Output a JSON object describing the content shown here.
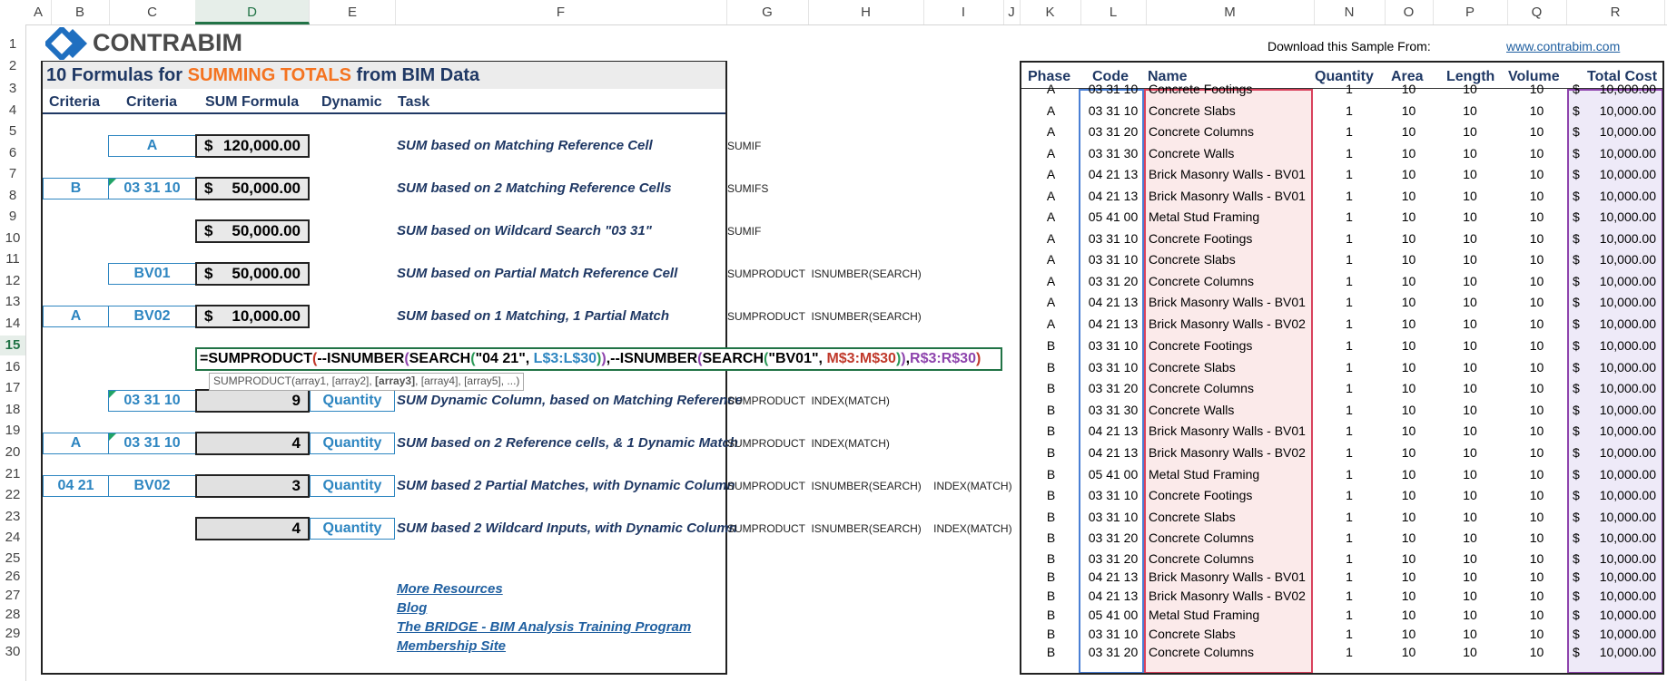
{
  "columns": [
    "A",
    "B",
    "C",
    "D",
    "E",
    "F",
    "G",
    "H",
    "I",
    "J",
    "K",
    "L",
    "M",
    "N",
    "O",
    "P",
    "Q",
    "R"
  ],
  "selected_column": "D",
  "rows": [
    "1",
    "2",
    "3",
    "4",
    "5",
    "6",
    "7",
    "8",
    "9",
    "10",
    "11",
    "12",
    "13",
    "14",
    "15",
    "16",
    "17",
    "18",
    "19",
    "20",
    "21",
    "22",
    "23",
    "24",
    "25",
    "26",
    "27",
    "28",
    "29",
    "30"
  ],
  "selected_row": "15",
  "logo": {
    "text": "CONTRABIM"
  },
  "download": {
    "label": "Download this Sample From:",
    "link": "www.contrabim.com"
  },
  "title": {
    "part1": "10 Formulas for ",
    "highlight": "SUMMING TOTALS",
    "part2": " from BIM Data"
  },
  "headers": {
    "criteria1": "Criteria",
    "criteria2": "Criteria",
    "sum_formula": "SUM Formula",
    "dynamic": "Dynamic",
    "task": "Task"
  },
  "formulas": [
    {
      "criteria1": "",
      "criteria2": "A",
      "dollar": "$",
      "value": "120,000.00",
      "dynamic": "",
      "task": "SUM based on Matching Reference Cell",
      "func": "SUMIF"
    },
    {
      "criteria1": "B",
      "criteria2": "03 31 10",
      "dollar": "$",
      "value": "50,000.00",
      "dynamic": "",
      "task": "SUM based on 2 Matching Reference Cells",
      "func": "SUMIFS"
    },
    {
      "criteria1": "",
      "criteria2": "",
      "dollar": "$",
      "value": "50,000.00",
      "dynamic": "",
      "task": "SUM based on Wildcard Search \"03 31\"",
      "func": "SUMIF"
    },
    {
      "criteria1": "",
      "criteria2": "BV01",
      "dollar": "$",
      "value": "50,000.00",
      "dynamic": "",
      "task": "SUM based on Partial Match Reference Cell",
      "func": "SUMPRODUCT  ISNUMBER(SEARCH)"
    },
    {
      "criteria1": "A",
      "criteria2": "BV02",
      "dollar": "$",
      "value": "10,000.00",
      "dynamic": "",
      "task": "SUM based on 1 Matching, 1 Partial Match",
      "func": "SUMPRODUCT  ISNUMBER(SEARCH)"
    },
    {
      "criteria1": "",
      "criteria2": "03 31 10",
      "dollar": "",
      "value": "9",
      "dynamic": "Quantity",
      "task": "SUM Dynamic Column, based on Matching Reference",
      "func": "SUMPRODUCT  INDEX(MATCH)"
    },
    {
      "criteria1": "A",
      "criteria2": "03 31 10",
      "dollar": "",
      "value": "4",
      "dynamic": "Quantity",
      "task": "SUM based on 2 Reference cells, & 1 Dynamic Match",
      "func": "SUMPRODUCT  INDEX(MATCH)"
    },
    {
      "criteria1": "04 21",
      "criteria2": "BV02",
      "dollar": "",
      "value": "3",
      "dynamic": "Quantity",
      "task": "SUM based 2 Partial Matches, with Dynamic Column",
      "func": "SUMPRODUCT  ISNUMBER(SEARCH)    INDEX(MATCH)"
    },
    {
      "criteria1": "",
      "criteria2": "",
      "dollar": "",
      "value": "4",
      "dynamic": "Quantity",
      "task": "SUM based 2 Wildcard Inputs, with Dynamic Column",
      "func": "SUMPRODUCT  ISNUMBER(SEARCH)    INDEX(MATCH)"
    }
  ],
  "formula_edit": {
    "p1": "=SUMPRODUCT",
    "p2": "(",
    "p3": "--ISNUMBER",
    "p4": "(",
    "p5": "SEARCH",
    "p6": "(",
    "p7": "\"04 21\", ",
    "p8": "L$3:L$30",
    "p9": ")",
    "p10": ")",
    "p11": ",--ISNUMBER",
    "p12": "(",
    "p13": "SEARCH",
    "p14": "(",
    "p15": "\"BV01\", ",
    "p16": "M$3:M$30",
    "p17": ")",
    "p18": ")",
    "p19": ",",
    "p20": "R$3:R$30",
    "p21": ")"
  },
  "tooltip": {
    "pre": "SUMPRODUCT(array1, [array2], ",
    "bold": "[array3]",
    "post": ", [array4], [array5], ...)"
  },
  "links": [
    "More Resources",
    "Blog",
    "The BRIDGE - BIM Analysis Training Program",
    "Membership Site"
  ],
  "table": {
    "headers": [
      "Phase",
      "Code",
      "Name",
      "Quantity",
      "Area",
      "Length",
      "Volume",
      "Total Cost"
    ],
    "rows": [
      [
        "A",
        "03 31 10",
        "Concrete Footings",
        "1",
        "10",
        "10",
        "10",
        "$",
        "10,000.00"
      ],
      [
        "A",
        "03 31 10",
        "Concrete Slabs",
        "1",
        "10",
        "10",
        "10",
        "$",
        "10,000.00"
      ],
      [
        "A",
        "03 31 20",
        "Concrete Columns",
        "1",
        "10",
        "10",
        "10",
        "$",
        "10,000.00"
      ],
      [
        "A",
        "03 31 30",
        "Concrete Walls",
        "1",
        "10",
        "10",
        "10",
        "$",
        "10,000.00"
      ],
      [
        "A",
        "04 21 13",
        "Brick Masonry Walls - BV01",
        "1",
        "10",
        "10",
        "10",
        "$",
        "10,000.00"
      ],
      [
        "A",
        "04 21 13",
        "Brick Masonry Walls - BV01",
        "1",
        "10",
        "10",
        "10",
        "$",
        "10,000.00"
      ],
      [
        "A",
        "05 41 00",
        "Metal Stud Framing",
        "1",
        "10",
        "10",
        "10",
        "$",
        "10,000.00"
      ],
      [
        "A",
        "03 31 10",
        "Concrete Footings",
        "1",
        "10",
        "10",
        "10",
        "$",
        "10,000.00"
      ],
      [
        "A",
        "03 31 10",
        "Concrete Slabs",
        "1",
        "10",
        "10",
        "10",
        "$",
        "10,000.00"
      ],
      [
        "A",
        "03 31 20",
        "Concrete Columns",
        "1",
        "10",
        "10",
        "10",
        "$",
        "10,000.00"
      ],
      [
        "A",
        "04 21 13",
        "Brick Masonry Walls - BV01",
        "1",
        "10",
        "10",
        "10",
        "$",
        "10,000.00"
      ],
      [
        "A",
        "04 21 13",
        "Brick Masonry Walls - BV02",
        "1",
        "10",
        "10",
        "10",
        "$",
        "10,000.00"
      ],
      [
        "B",
        "03 31 10",
        "Concrete Footings",
        "1",
        "10",
        "10",
        "10",
        "$",
        "10,000.00"
      ],
      [
        "B",
        "03 31 10",
        "Concrete Slabs",
        "1",
        "10",
        "10",
        "10",
        "$",
        "10,000.00"
      ],
      [
        "B",
        "03 31 20",
        "Concrete Columns",
        "1",
        "10",
        "10",
        "10",
        "$",
        "10,000.00"
      ],
      [
        "B",
        "03 31 30",
        "Concrete Walls",
        "1",
        "10",
        "10",
        "10",
        "$",
        "10,000.00"
      ],
      [
        "B",
        "04 21 13",
        "Brick Masonry Walls - BV01",
        "1",
        "10",
        "10",
        "10",
        "$",
        "10,000.00"
      ],
      [
        "B",
        "04 21 13",
        "Brick Masonry Walls - BV02",
        "1",
        "10",
        "10",
        "10",
        "$",
        "10,000.00"
      ],
      [
        "B",
        "05 41 00",
        "Metal Stud Framing",
        "1",
        "10",
        "10",
        "10",
        "$",
        "10,000.00"
      ],
      [
        "B",
        "03 31 10",
        "Concrete Footings",
        "1",
        "10",
        "10",
        "10",
        "$",
        "10,000.00"
      ],
      [
        "B",
        "03 31 10",
        "Concrete Slabs",
        "1",
        "10",
        "10",
        "10",
        "$",
        "10,000.00"
      ],
      [
        "B",
        "03 31 20",
        "Concrete Columns",
        "1",
        "10",
        "10",
        "10",
        "$",
        "10,000.00"
      ],
      [
        "B",
        "03 31 20",
        "Concrete Columns",
        "1",
        "10",
        "10",
        "10",
        "$",
        "10,000.00"
      ],
      [
        "B",
        "04 21 13",
        "Brick Masonry Walls - BV01",
        "1",
        "10",
        "10",
        "10",
        "$",
        "10,000.00"
      ],
      [
        "B",
        "04 21 13",
        "Brick Masonry Walls - BV02",
        "1",
        "10",
        "10",
        "10",
        "$",
        "10,000.00"
      ],
      [
        "B",
        "05 41 00",
        "Metal Stud Framing",
        "1",
        "10",
        "10",
        "10",
        "$",
        "10,000.00"
      ],
      [
        "B",
        "03 31 10",
        "Concrete Slabs",
        "1",
        "10",
        "10",
        "10",
        "$",
        "10,000.00"
      ],
      [
        "B",
        "03 31 20",
        "Concrete Columns",
        "1",
        "10",
        "10",
        "10",
        "$",
        "10,000.00"
      ]
    ]
  },
  "colors": {
    "accent_orange": "#f47320",
    "title_blue": "#1f3864",
    "input_blue": "#2e86c1",
    "excel_green": "#217346"
  }
}
